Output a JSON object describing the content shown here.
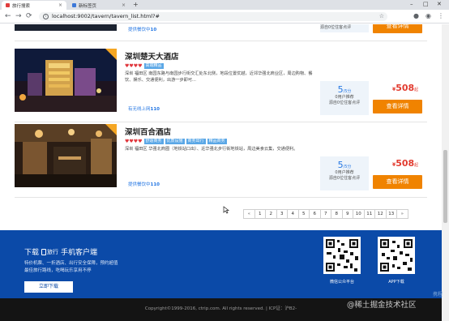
{
  "browser": {
    "tabs": [
      {
        "label": "旅行搜索",
        "active": true
      },
      {
        "label": "新标签页",
        "active": false
      }
    ],
    "new_tab_symbol": "+",
    "window_controls": [
      "–",
      "□",
      "✕"
    ],
    "url": "localhost:9002/tavern/tavern_list.html?#",
    "nav": {
      "back": "←",
      "forward": "→",
      "reload": "⟳"
    }
  },
  "partial_card": {
    "link_prefix": "提供餐饮中",
    "link_brand": "10"
  },
  "hotels": [
    {
      "name": "深圳楚天大酒店",
      "hearts": "♥♥♥♥",
      "tags": [
        "高端精品"
      ],
      "desc": "深圳 福田区 南园东路与南园步行街交汇处东北侧，地段位置优越，近邻华强北商业区，周边购物、餐饮、娱乐、交通便利，出游一步即可...",
      "link_prefix": "有无线上网",
      "link_brand": "110",
      "score": "5",
      "score_unit": "/5分",
      "score_line1": "0用户推荐",
      "score_line2": "源自0位住客点评",
      "currency": "¥",
      "price": "508",
      "price_suffix": "起",
      "detail_label": "查看详情"
    },
    {
      "name": "深圳百合酒店",
      "hearts": "♥♥♥♥",
      "tags": [
        "舒适商务",
        "优质设施",
        "商务出行",
        "精品商务"
      ],
      "desc": "深圳 福田区 华强北商圈（地铁站口出）、近华强北步行街地铁站，周边美食云集，交通便利。",
      "link_prefix": "提供餐饮中",
      "link_brand": "110",
      "score": "5",
      "score_unit": "/5分",
      "score_line1": "0用户推荐",
      "score_line2": "源自0位住客点评",
      "currency": "¥",
      "price": "508",
      "price_suffix": "起",
      "detail_label": "查看详情"
    }
  ],
  "pagination": {
    "prev": "«",
    "pages": [
      "1",
      "2",
      "3",
      "4",
      "5",
      "6",
      "7",
      "8",
      "9",
      "10",
      "11",
      "12",
      "13"
    ],
    "next": "»"
  },
  "footer": {
    "download_prefix": "下载",
    "brand": "旅行",
    "download_suffix": "手机客户端",
    "sub_line1": "特价机票、一折酒店、出行安全保障，预约超值",
    "sub_line2": "最佳旅行路线，吃喝玩乐享用不停",
    "download_btn": "立即下载",
    "qr_labels": [
      "微信公众平台",
      "APP下载"
    ],
    "copyright": "Copyright©1999-2016, ctrip.com. All rights reserved. | ICP证：沪B2-"
  },
  "watermark": "@稀土掘金技术社区",
  "watermark_side": "携程",
  "colors": {
    "accent_blue": "#2577e3",
    "price_red": "#e23b2f",
    "button_orange": "#f08300",
    "footer_blue": "#0b4aa8"
  }
}
